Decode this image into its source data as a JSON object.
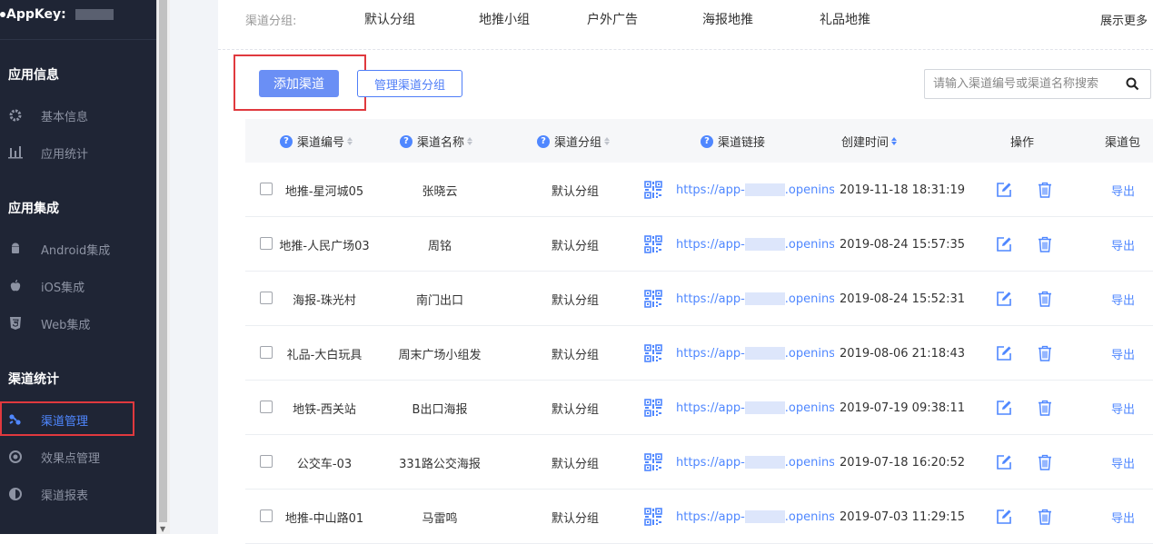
{
  "sidebar": {
    "appkey_label": "AppKey:",
    "sections": [
      {
        "title": "应用信息",
        "items": [
          {
            "label": "基本信息",
            "icon": "gear-icon"
          },
          {
            "label": "应用统计",
            "icon": "bar-chart-icon"
          }
        ]
      },
      {
        "title": "应用集成",
        "items": [
          {
            "label": "Android集成",
            "icon": "android-icon"
          },
          {
            "label": "iOS集成",
            "icon": "apple-icon"
          },
          {
            "label": "Web集成",
            "icon": "html5-icon"
          }
        ]
      },
      {
        "title": "渠道统计",
        "items": [
          {
            "label": "渠道管理",
            "icon": "channel-manage-icon",
            "active": true
          },
          {
            "label": "效果点管理",
            "icon": "target-icon"
          },
          {
            "label": "渠道报表",
            "icon": "report-icon"
          }
        ]
      }
    ]
  },
  "groups": {
    "label": "渠道分组:",
    "items": [
      "默认分组",
      "地推小组",
      "户外广告",
      "海报地推",
      "礼品地推"
    ],
    "more": "展示更多"
  },
  "toolbar": {
    "add_label": "添加渠道",
    "manage_label": "管理渠道分组",
    "search_placeholder": "请输入渠道编号或渠道名称搜索"
  },
  "table": {
    "headers": {
      "code": "渠道编号",
      "name": "渠道名称",
      "group": "渠道分组",
      "link": "渠道链接",
      "created": "创建时间",
      "ops": "操作",
      "pkg": "渠道包"
    },
    "export_label": "导出",
    "rows": [
      {
        "code": "地推-星河城05",
        "name": "张晓云",
        "group": "默认分组",
        "link_pre": "https://app-",
        "link_post": ".openinsta",
        "created": "2019-11-18 18:31:19"
      },
      {
        "code": "地推-人民广场03",
        "name": "周铭",
        "group": "默认分组",
        "link_pre": "https://app-",
        "link_post": ".openinsta",
        "created": "2019-08-24 15:57:35"
      },
      {
        "code": "海报-珠光村",
        "name": "南门出口",
        "group": "默认分组",
        "link_pre": "https://app-",
        "link_post": ".openinsta",
        "created": "2019-08-24 15:52:31"
      },
      {
        "code": "礼品-大白玩具",
        "name": "周末广场小组发",
        "group": "默认分组",
        "link_pre": "https://app-",
        "link_post": ".openinsta",
        "created": "2019-08-06 21:18:43"
      },
      {
        "code": "地铁-西关站",
        "name": "B出口海报",
        "group": "默认分组",
        "link_pre": "https://app-",
        "link_post": ".openinsta",
        "created": "2019-07-19 09:38:11"
      },
      {
        "code": "公交车-03",
        "name": "331路公交海报",
        "group": "默认分组",
        "link_pre": "https://app-",
        "link_post": ".openinsta",
        "created": "2019-07-18 16:20:52"
      },
      {
        "code": "地推-中山路01",
        "name": "马雷鸣",
        "group": "默认分组",
        "link_pre": "https://app-",
        "link_post": ".openinsta",
        "created": "2019-07-03 11:29:15"
      }
    ]
  },
  "colors": {
    "accent": "#4f87ff",
    "sidebar_bg": "#1f2535",
    "highlight": "#e0393e"
  }
}
